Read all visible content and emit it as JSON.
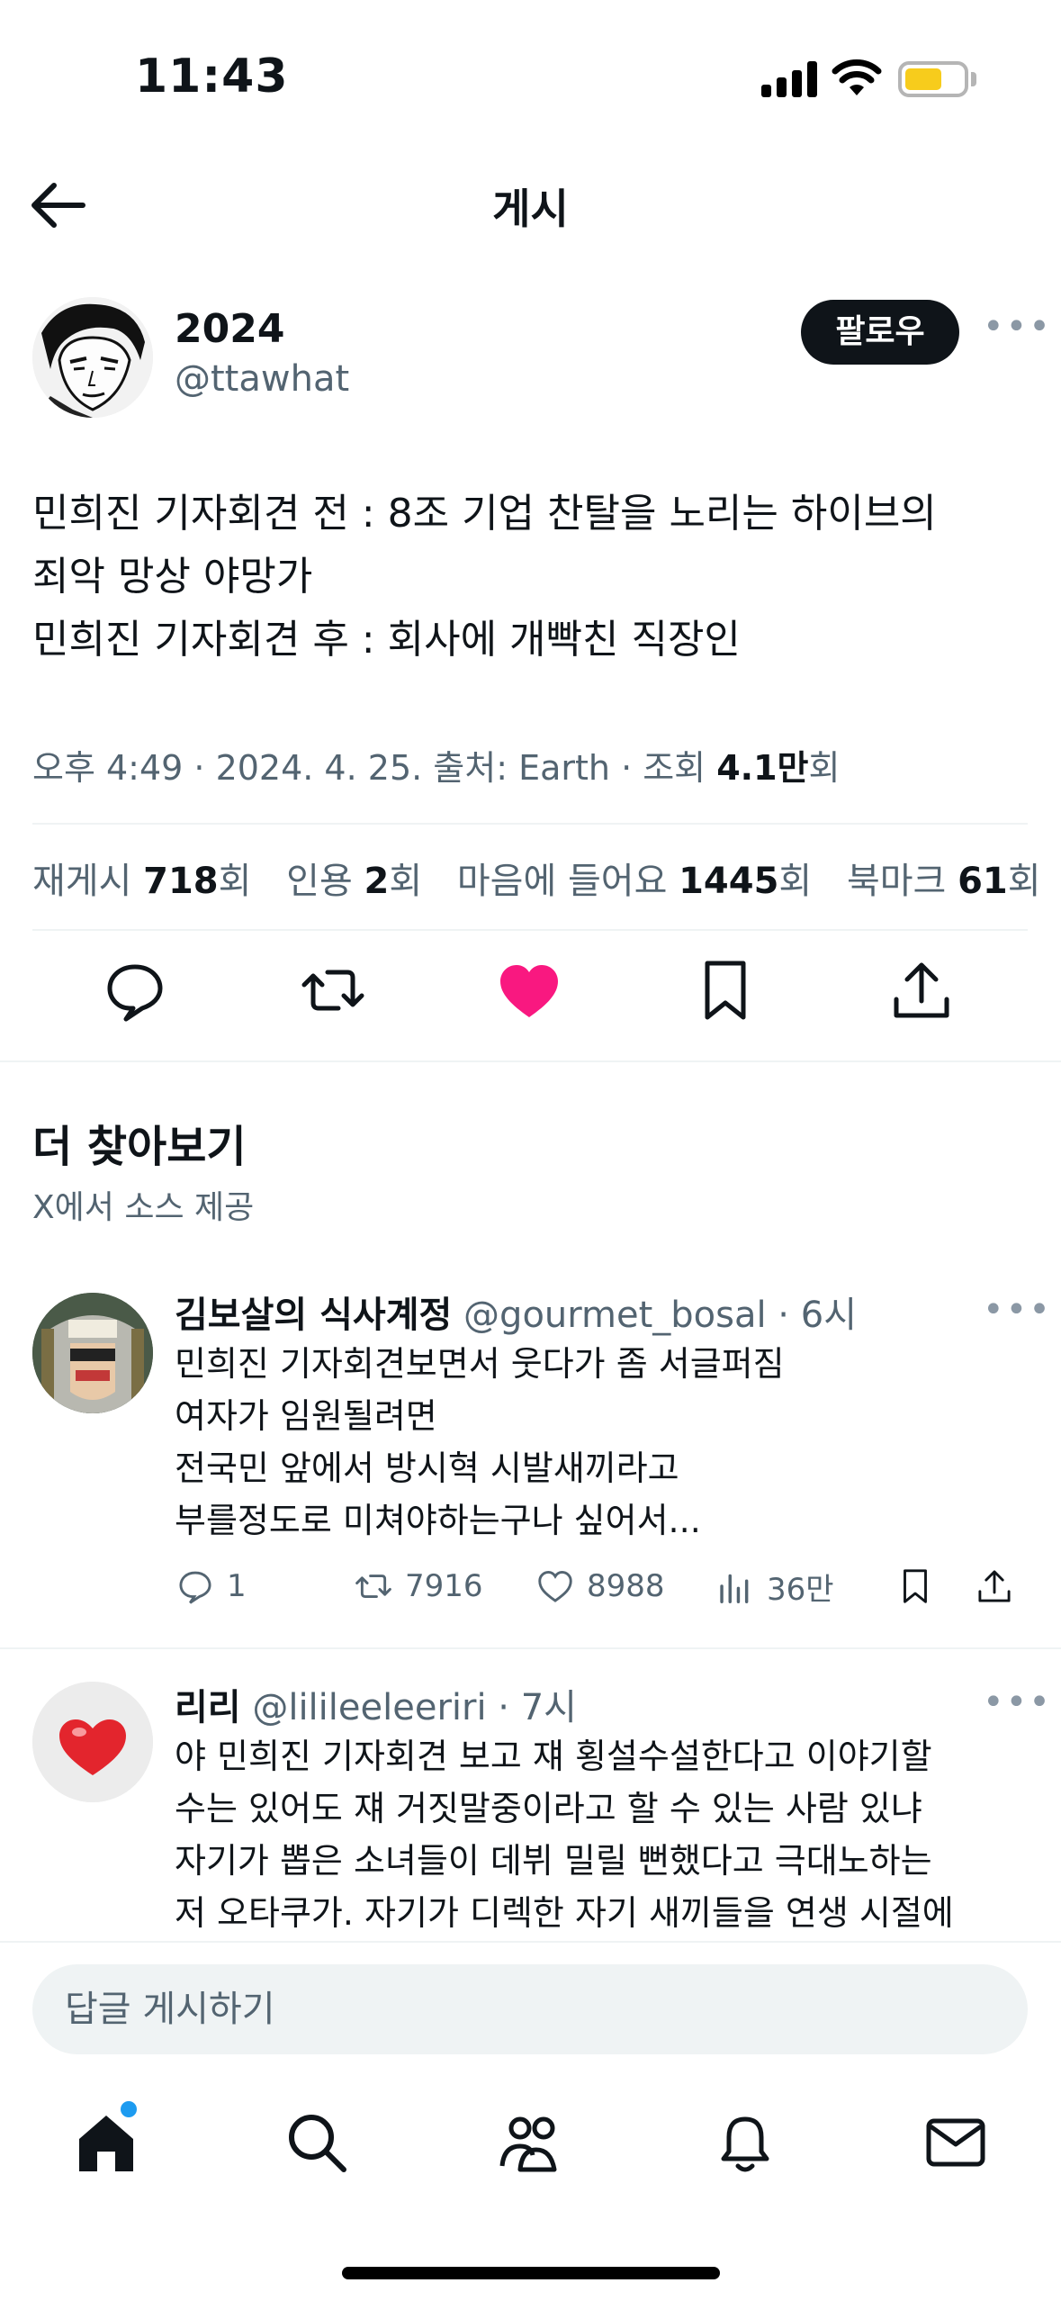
{
  "status_bar": {
    "time": "11:43"
  },
  "header": {
    "title": "게시"
  },
  "post": {
    "author_name": "2024",
    "author_handle": "@ttawhat",
    "follow_label": "팔로우",
    "text_lines": [
      "민희진 기자회견 전 : 8조 기업 찬탈을 노리는 하이브의",
      "죄악 망상 야망가",
      "민희진 기자회견 후 : 회사에 개빡친 직장인"
    ],
    "meta_prefix": "오후 4:49 · 2024. 4. 25. 출처: Earth · 조회 ",
    "views": "4.1만",
    "views_suffix": "회",
    "stats": {
      "reposts_label": "재게시",
      "reposts": "718",
      "quotes_label": "인용",
      "quotes": "2",
      "likes_label": "마음에 들어요",
      "likes": "1445",
      "bookmarks_label": "북마크",
      "bookmarks": "61",
      "unit": "회"
    }
  },
  "discover": {
    "title": "더 찾아보기",
    "subtitle": "X에서 소스 제공"
  },
  "replies": [
    {
      "name": "김보살의 식사계정",
      "handle": "@gourmet_bosal",
      "time": "6시",
      "lines": [
        "민희진 기자회견보면서 웃다가 좀 서글퍼짐",
        "여자가 임원될려면",
        "전국민 앞에서 방시혁 시발새끼라고",
        "부를정도로 미쳐야하는구나 싶어서..."
      ],
      "replies": "1",
      "reposts": "7916",
      "likes": "8988",
      "views": "36만"
    },
    {
      "name": "리리",
      "handle": "@lilileeleeriri",
      "time": "7시",
      "lines": [
        "야 민희진 기자회견 보고 쟤 횡설수설한다고 이야기할",
        "수는 있어도 쟤 거짓말중이라고 할 수 있는 사람 있냐",
        "자기가 뽑은 소녀들이 데뷔 밀릴 뻔했다고 극대노하는",
        "저 오타쿠가. 자기가 디렉한 자기 새끼들을 연생 시절에"
      ]
    }
  ],
  "compose": {
    "placeholder": "답글 게시하기"
  },
  "colors": {
    "like": "#f91880",
    "follow_bg": "#0f1419",
    "accent": "#1d9bf0",
    "battery": "#f7cc1c"
  },
  "icons": {
    "tabs": [
      "home-icon",
      "search-icon",
      "communities-icon",
      "notifications-icon",
      "messages-icon"
    ],
    "actions": [
      "reply-icon",
      "repost-icon",
      "like-icon",
      "bookmark-icon",
      "share-icon"
    ]
  }
}
